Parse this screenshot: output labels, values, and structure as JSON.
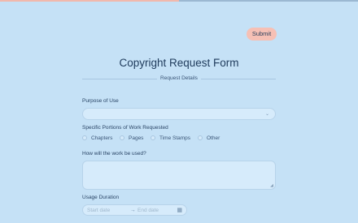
{
  "progress": {
    "fraction": 0.5,
    "color": "#f1b8ac"
  },
  "toolbar": {
    "submit_label": "Submit"
  },
  "form": {
    "title": "Copyright Request Form",
    "section_label": "Request Details",
    "purpose": {
      "label": "Purpose of Use",
      "value": "",
      "icon": "chevron-down-icon"
    },
    "portions": {
      "label": "Specific Portions of Work Requested",
      "options": [
        "Chapters",
        "Pages",
        "Time Stamps",
        "Other"
      ]
    },
    "usage_description": {
      "label": "How will the work be used?",
      "value": ""
    },
    "duration": {
      "label": "Usage Duration",
      "start_placeholder": "Start date",
      "separator": "→",
      "end_placeholder": "End date",
      "icon": "calendar-icon"
    }
  },
  "colors": {
    "background": "#c5e1f6",
    "accent": "#f6c0b5",
    "field": "#d6ebfb"
  }
}
